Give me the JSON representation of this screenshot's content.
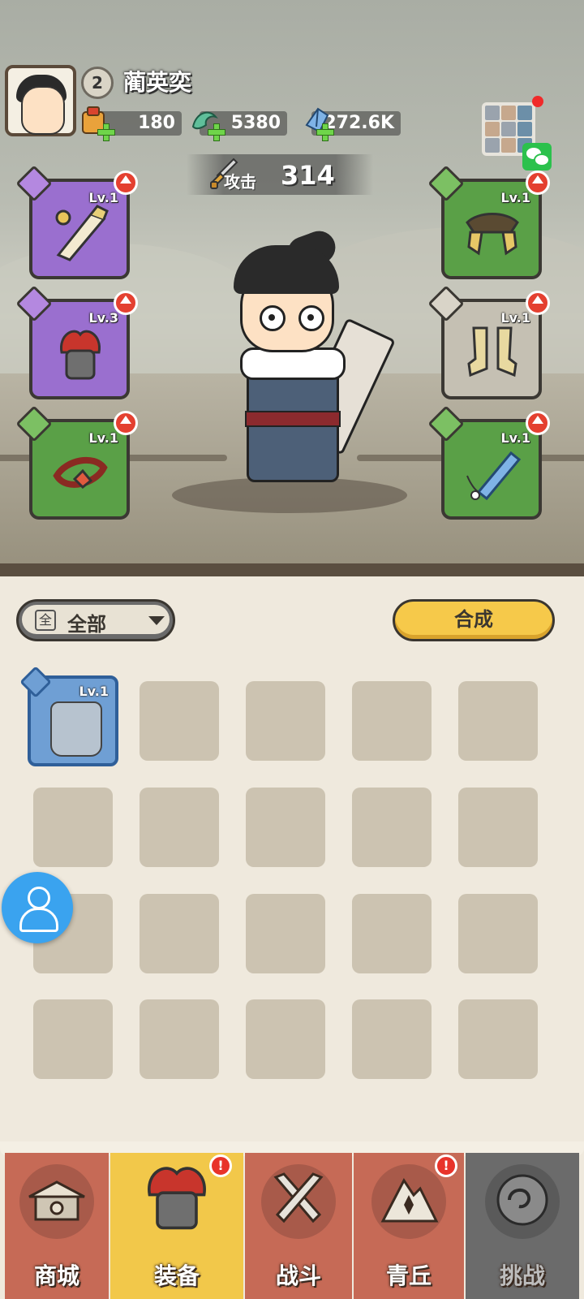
{
  "player": {
    "level": "2",
    "name": "蔺英奕"
  },
  "resources": [
    {
      "icon": "scroll-bag-icon",
      "value": "180"
    },
    {
      "icon": "jade-dragon-icon",
      "value": "5380"
    },
    {
      "icon": "blue-crystal-icon",
      "value": "272.6K"
    }
  ],
  "attack": {
    "label": "攻击",
    "value": "314"
  },
  "equip_left": [
    {
      "slot": "weapon",
      "level": "Lv.1",
      "rarity": "purple"
    },
    {
      "slot": "armor",
      "level": "Lv.3",
      "rarity": "purple"
    },
    {
      "slot": "belt",
      "level": "Lv.1",
      "rarity": "green"
    }
  ],
  "equip_right": [
    {
      "slot": "shoulder",
      "level": "Lv.1",
      "rarity": "green"
    },
    {
      "slot": "boots",
      "level": "Lv.1",
      "rarity": "grey"
    },
    {
      "slot": "accessory",
      "level": "Lv.1",
      "rarity": "green"
    }
  ],
  "filter": {
    "icon_char": "全",
    "label": "全部"
  },
  "synth_button": "合成",
  "inventory": [
    {
      "level": "Lv.1",
      "rarity": "blue",
      "icon": "ice-helmet-icon"
    }
  ],
  "tabs": [
    {
      "label": "商城",
      "icon": "pagoda-icon",
      "badge": ""
    },
    {
      "label": "装备",
      "icon": "helmet-icon",
      "badge": "!"
    },
    {
      "label": "战斗",
      "icon": "crossed-swords-icon",
      "badge": ""
    },
    {
      "label": "青丘",
      "icon": "mountain-icon",
      "badge": "!"
    },
    {
      "label": "挑战",
      "icon": "swirl-orb-icon",
      "badge": ""
    }
  ],
  "colors": {
    "active_tab": "#f2c84a",
    "tab_bg": "#c66a56",
    "locked_tab": "#6b6b6b"
  }
}
